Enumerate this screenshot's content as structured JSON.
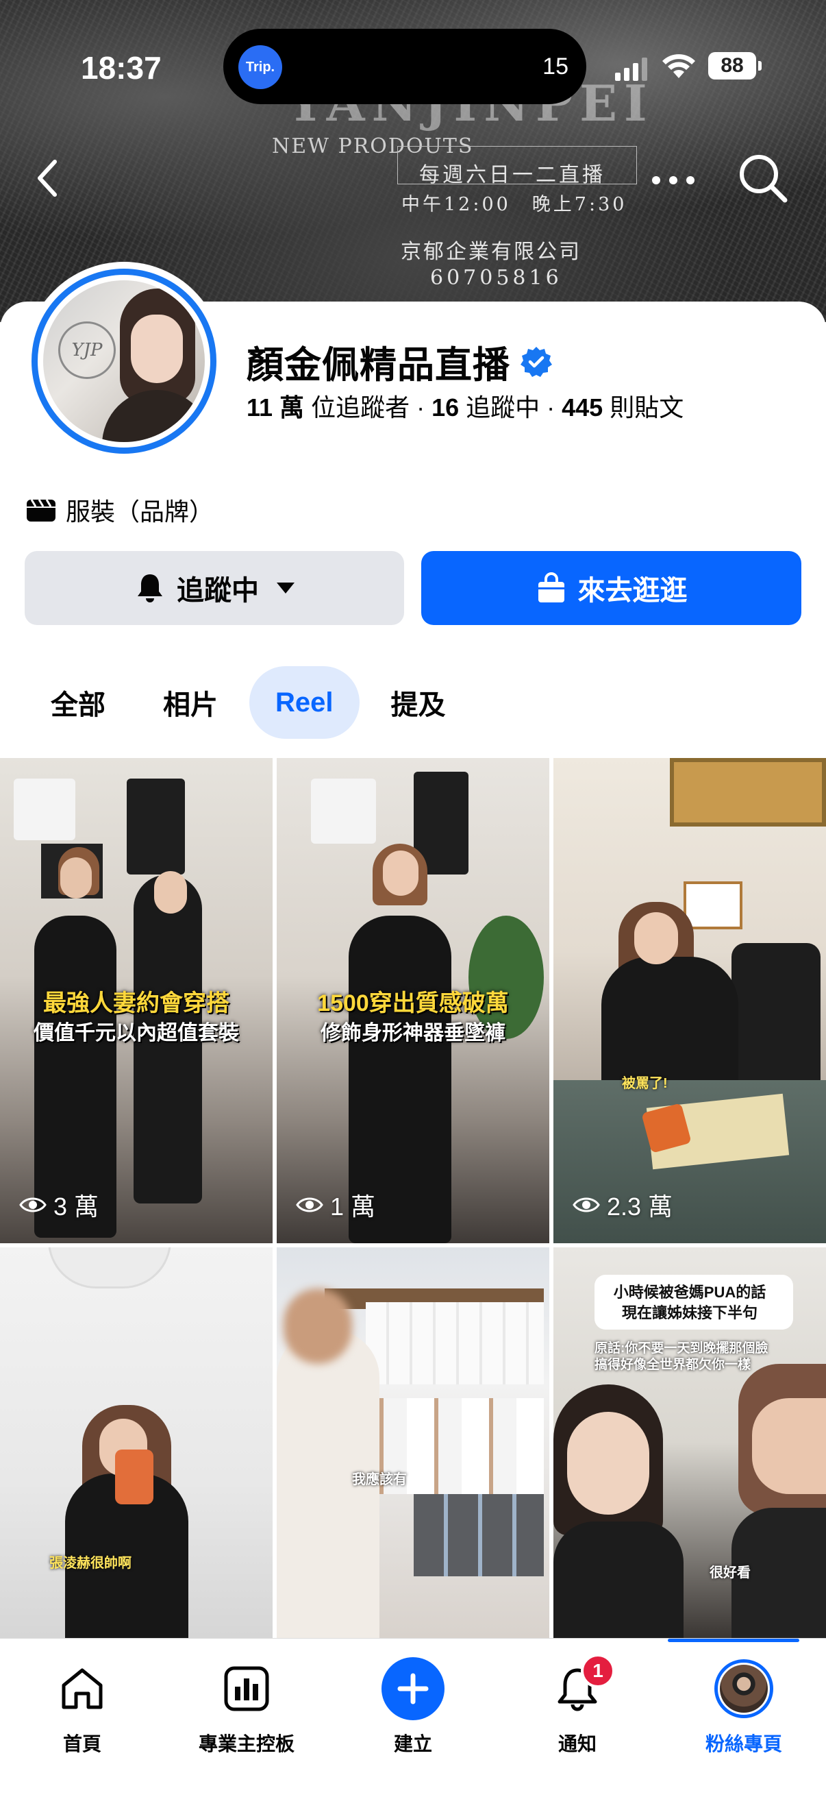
{
  "status": {
    "time": "18:37",
    "island_app": "Trip.",
    "island_number": "15",
    "battery": "88"
  },
  "cover": {
    "brand": "YANJINPEI",
    "subtitle": "NEW PRODOUTS",
    "schedule": "每週六日一二直播",
    "times": "中午12:00　晚上7:30",
    "company": "京郁企業有限公司",
    "phone": "60705816"
  },
  "profile": {
    "avatar_logo": "YJP",
    "name": "顏金佩精品直播",
    "followers_count": "11 萬",
    "followers_label": " 位追蹤者",
    "sep": " · ",
    "following_count": "16",
    "following_label": " 追蹤中",
    "posts_count": "445",
    "posts_label": " 則貼文",
    "category": "服裝（品牌）"
  },
  "actions": {
    "following_label": "追蹤中",
    "shop_label": "來去逛逛"
  },
  "tabs": [
    {
      "label": "全部"
    },
    {
      "label": "相片"
    },
    {
      "label": "Reel",
      "active": true
    },
    {
      "label": "提及"
    }
  ],
  "reels": [
    {
      "title": "最強人妻約會穿搭",
      "subtitle": "價值千元以內超值套裝",
      "views": "3 萬"
    },
    {
      "title": "1500穿出質感破萬",
      "subtitle": "修飾身形神器垂墜褲",
      "views": "1 萬"
    },
    {
      "caption": "被罵了!",
      "views": "2.3 萬"
    },
    {
      "caption": "張淩赫很帥啊"
    },
    {
      "caption": "我應該有"
    },
    {
      "title_line1": "小時候被爸媽PUA的話",
      "title_line2": "現在讓姊妹接下半句",
      "quote_line1": "原話:你不要一天到晚擺那個臉",
      "quote_line2": "搞得好像全世界都欠你一樣",
      "caption": "很好看"
    }
  ],
  "nav": [
    {
      "label": "首頁"
    },
    {
      "label": "專業主控板"
    },
    {
      "label": "建立"
    },
    {
      "label": "通知",
      "badge": "1"
    },
    {
      "label": "粉絲專頁",
      "active": true
    }
  ],
  "colors": {
    "accent": "#0866ff",
    "verified": "#1877f2",
    "badge": "#e41e3f",
    "secondary_button": "#e4e6eb"
  }
}
